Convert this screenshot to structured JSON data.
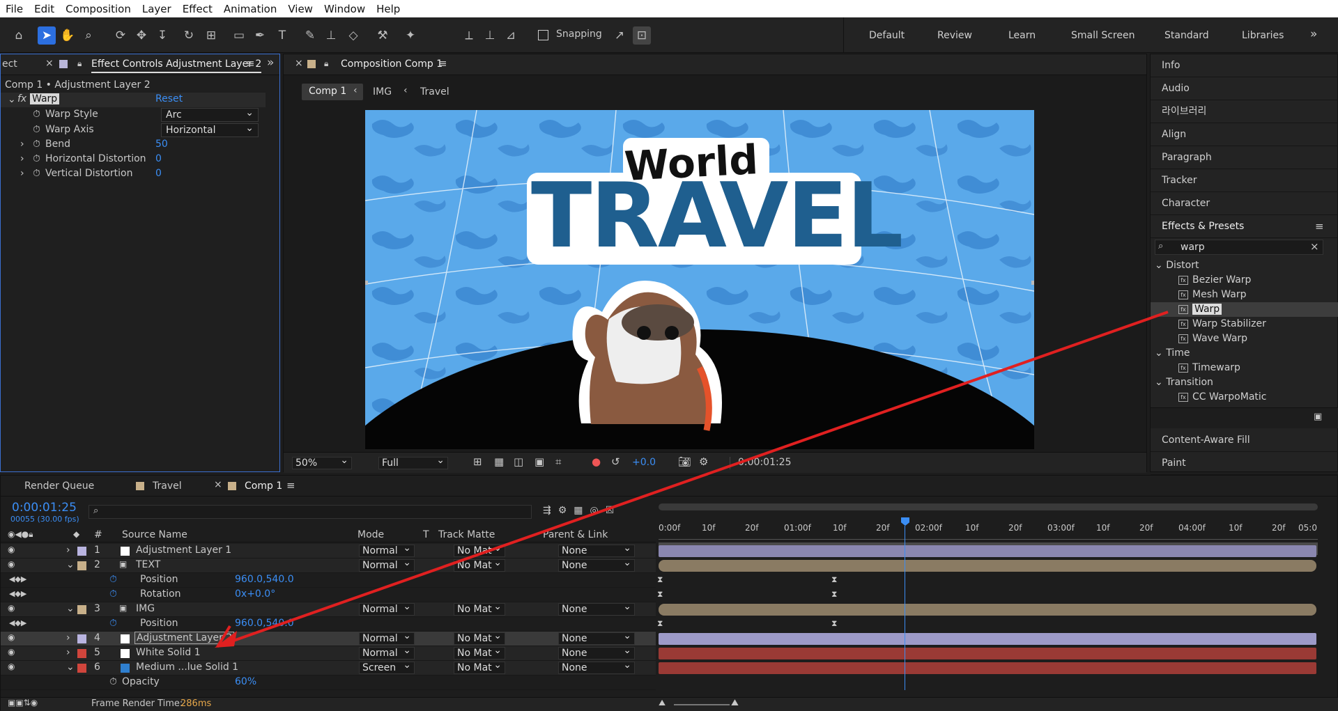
{
  "menu": [
    "File",
    "Edit",
    "Composition",
    "Layer",
    "Effect",
    "Animation",
    "View",
    "Window",
    "Help"
  ],
  "toolbar": {
    "snapping": "Snapping"
  },
  "workspaces": [
    "Default",
    "Review",
    "Learn",
    "Small Screen",
    "Standard",
    "Libraries"
  ],
  "effect_controls": {
    "tab_left": "ect",
    "tab": "Effect Controls Adjustment Layer 2",
    "breadcrumb": "Comp 1 • Adjustment Layer 2",
    "effect_name": "Warp",
    "reset": "Reset",
    "props": [
      {
        "name": "Warp Style",
        "value": "Arc"
      },
      {
        "name": "Warp Axis",
        "value": "Horizontal"
      },
      {
        "name": "Bend",
        "value": "50"
      },
      {
        "name": "Horizontal Distortion",
        "value": "0"
      },
      {
        "name": "Vertical Distortion",
        "value": "0"
      }
    ]
  },
  "composition": {
    "tab": "Composition Comp 1",
    "crumbs": [
      "Comp 1",
      "IMG",
      "Travel"
    ],
    "title_small": "World",
    "title_big": "TRAVEL",
    "zoom": "50%",
    "resolution": "Full",
    "exposure": "+0.0",
    "timecode": "0:00:01:25"
  },
  "right_panel": {
    "items": [
      "Info",
      "Audio",
      "라이브러리",
      "Align",
      "Paragraph",
      "Tracker",
      "Character"
    ],
    "effects_title": "Effects & Presets",
    "search": "warp",
    "tree": [
      {
        "label": "Distort",
        "type": "group"
      },
      {
        "label": "Bezier Warp",
        "type": "fx"
      },
      {
        "label": "Mesh Warp",
        "type": "fx"
      },
      {
        "label": "Warp",
        "type": "fx",
        "selected": true
      },
      {
        "label": "Warp Stabilizer",
        "type": "fx"
      },
      {
        "label": "Wave Warp",
        "type": "fx"
      },
      {
        "label": "Time",
        "type": "group"
      },
      {
        "label": "Timewarp",
        "type": "fx"
      },
      {
        "label": "Transition",
        "type": "group"
      },
      {
        "label": "CC WarpoMatic",
        "type": "fx"
      }
    ],
    "bottom": [
      "Content-Aware Fill",
      "Paint"
    ]
  },
  "timeline": {
    "tabs": [
      "Render Queue",
      "Travel",
      "Comp 1"
    ],
    "timecode": "0:00:01:25",
    "frames": "00055 (30.00 fps)",
    "headers": {
      "num": "#",
      "source": "Source Name",
      "mode": "Mode",
      "t": "T",
      "matte": "Track Matte",
      "parent": "Parent & Link"
    },
    "rows": [
      {
        "kind": "layer",
        "num": "1",
        "name": "Adjustment Layer 1",
        "mode": "Normal",
        "matte": "No Mat",
        "parent": "None",
        "color": "#b9b4e0"
      },
      {
        "kind": "layer",
        "num": "2",
        "name": "TEXT",
        "mode": "Normal",
        "matte": "No Mat",
        "parent": "None",
        "color": "#c8b08a"
      },
      {
        "kind": "prop",
        "name": "Position",
        "value": "960.0,540.0"
      },
      {
        "kind": "prop",
        "name": "Rotation",
        "value": "0x+0.0°"
      },
      {
        "kind": "layer",
        "num": "3",
        "name": "IMG",
        "mode": "Normal",
        "matte": "No Mat",
        "parent": "None",
        "color": "#c8b08a"
      },
      {
        "kind": "prop",
        "name": "Position",
        "value": "960.0,540.0"
      },
      {
        "kind": "layer",
        "num": "4",
        "name": "Adjustment Layer 2",
        "mode": "Normal",
        "matte": "No Mat",
        "parent": "None",
        "color": "#b9b4e0"
      },
      {
        "kind": "layer",
        "num": "5",
        "name": "White Solid 1",
        "mode": "Normal",
        "matte": "No Mat",
        "parent": "None",
        "color": "#d0453c"
      },
      {
        "kind": "layer",
        "num": "6",
        "name": "Medium ...lue Solid 1",
        "mode": "Screen",
        "matte": "No Mat",
        "parent": "None",
        "color": "#d0453c"
      },
      {
        "kind": "prop",
        "name": "Opacity",
        "value": "60%"
      }
    ],
    "ruler": [
      "0:00f",
      "10f",
      "20f",
      "01:00f",
      "10f",
      "20f",
      "02:00f",
      "10f",
      "20f",
      "03:00f",
      "10f",
      "20f",
      "04:00f",
      "10f",
      "20f",
      "05:0"
    ],
    "render_label": "Frame Render Time:",
    "render_time": "286ms"
  },
  "colors": {
    "accent": "#3b8ef5",
    "sky": "#5aa9ea",
    "title_blue": "#1f5f8f",
    "arrow": "#e02020"
  }
}
